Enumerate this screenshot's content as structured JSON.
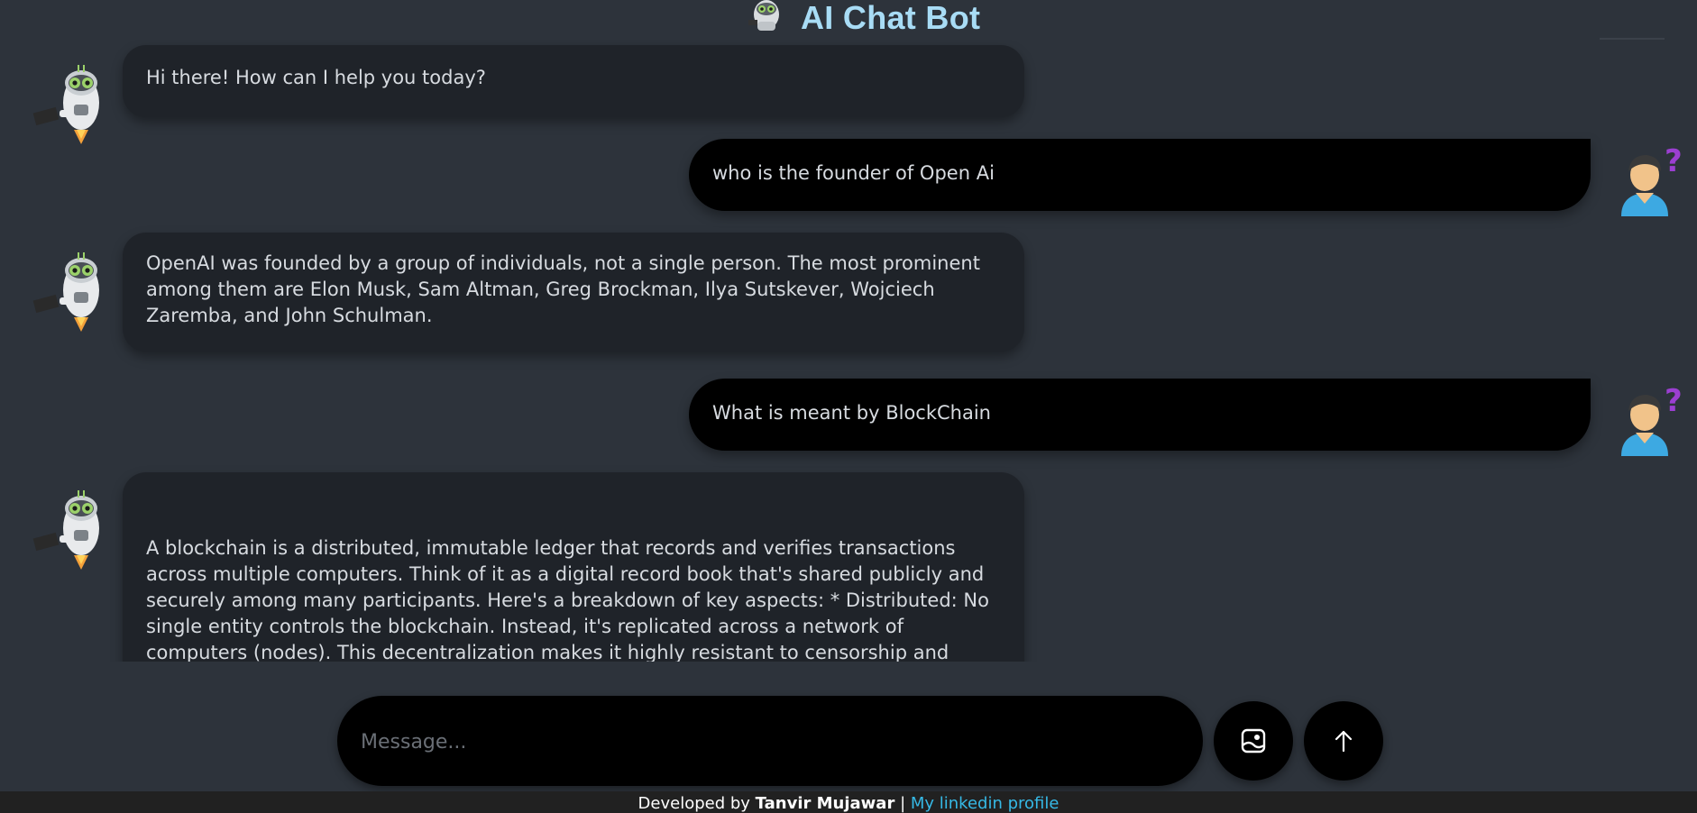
{
  "app": {
    "title": "AI Chat Bot"
  },
  "messages": [
    {
      "role": "bot",
      "text": "Hi there! How can I help you today?"
    },
    {
      "role": "user",
      "text": "who is the founder of Open Ai"
    },
    {
      "role": "bot",
      "text": "OpenAI was founded by a group of individuals, not a single person. The most prominent among them are Elon Musk, Sam Altman, Greg Brockman, Ilya Sutskever, Wojciech Zaremba, and John Schulman."
    },
    {
      "role": "user",
      "text": "What is meant by BlockChain"
    },
    {
      "role": "bot",
      "text": "A blockchain is a distributed, immutable ledger that records and verifies transactions across multiple computers. Think of it as a digital record book that's shared publicly and securely among many participants. Here's a breakdown of key aspects: * Distributed: No single entity controls the blockchain. Instead, it's replicated across a network of computers (nodes). This decentralization makes it highly resistant to censorship and single points of failure. * Immutable: Once a transaction is recorded on the blockchain, it cannot be altered or deleted. This property ensures data integrity. Each new transaction creates a \"block\" which is"
    }
  ],
  "composer": {
    "placeholder": "Message..."
  },
  "icons": {
    "bot_avatar": "robot-icon",
    "user_avatar": "user-question-icon",
    "image_button": "image-upload-icon",
    "send_button": "arrow-up-icon"
  },
  "footer": {
    "prefix": "Developed by ",
    "author": "Tanvir Mujawar",
    "separator": " | ",
    "link_text": "My linkedin profile"
  },
  "colors": {
    "background": "#2d333b",
    "bot_bubble": "#1f2329",
    "user_bubble": "#000000",
    "title": "#a8dcf5",
    "link": "#36b9e6"
  }
}
